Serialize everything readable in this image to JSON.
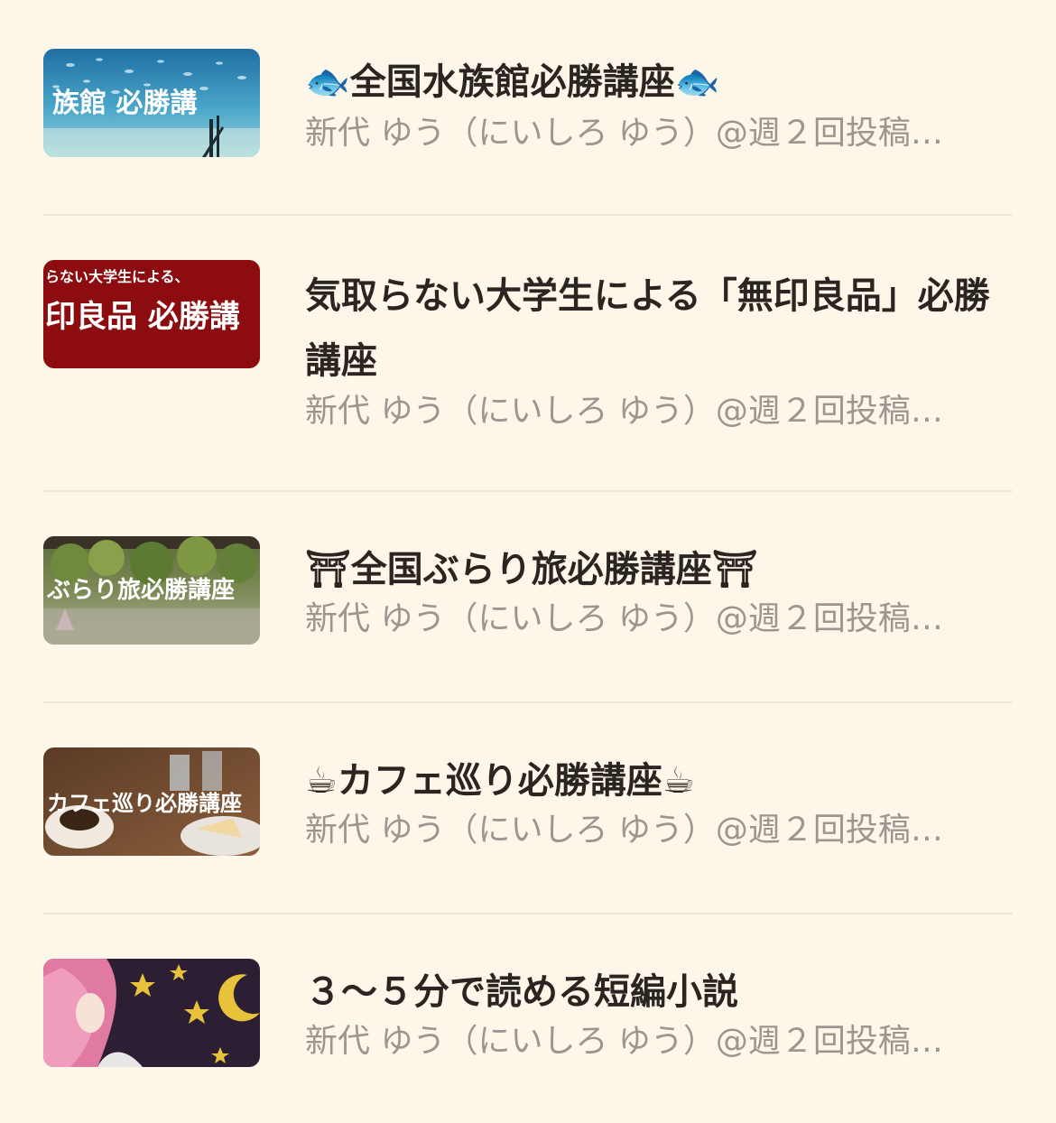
{
  "items": [
    {
      "title": "🐟全国水族館必勝講座🐟",
      "author": "新代 ゆう（にいしろ ゆう）@週２回投稿…",
      "thumb_text": "族館 必勝講",
      "thumb_icon": "aquarium-image"
    },
    {
      "title": "気取らない大学生による「無印良品」必勝講座",
      "author": "新代 ゆう（にいしろ ゆう）@週２回投稿…",
      "thumb_text_top": "らない大学生による、",
      "thumb_text": "印良品 必勝講",
      "thumb_icon": "muji-banner-image"
    },
    {
      "title": "⛩全国ぶらり旅必勝講座⛩",
      "author": "新代 ゆう（にいしろ ゆう）@週２回投稿…",
      "thumb_text": "ぶらり旅必勝講座",
      "thumb_icon": "garden-image"
    },
    {
      "title": "☕カフェ巡り必勝講座☕",
      "author": "新代 ゆう（にいしろ ゆう）@週２回投稿…",
      "thumb_text": "カフェ巡り必勝講座",
      "thumb_icon": "cafe-image"
    },
    {
      "title": "３～５分で読める短編小説",
      "author": "新代 ゆう（にいしろ ゆう）@週２回投稿…",
      "thumb_icon": "anime-girl-stars-image"
    }
  ]
}
